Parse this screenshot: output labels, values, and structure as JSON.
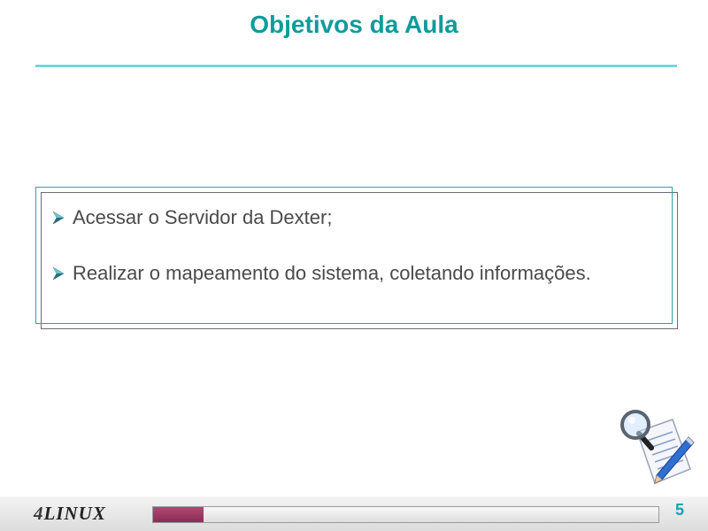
{
  "slide": {
    "title": "Objetivos da Aula",
    "bullets": [
      "Acessar o Servidor da Dexter;",
      "Realizar o mapeamento do sistema, coletando informações."
    ]
  },
  "footer": {
    "logo_number": "4",
    "logo_text": "LINUX",
    "page_number": "5",
    "progress_fraction": 0.1
  },
  "icons": {
    "bullet": "arrow-bullet-icon",
    "clipart": "document-magnifier-pen-icon"
  },
  "colors": {
    "title": "#109b9b",
    "accent": "#2cc5cf",
    "bullet_text": "#4a4a4a",
    "progress_fill": "#8b2d55",
    "page_number": "#16a2b4"
  }
}
